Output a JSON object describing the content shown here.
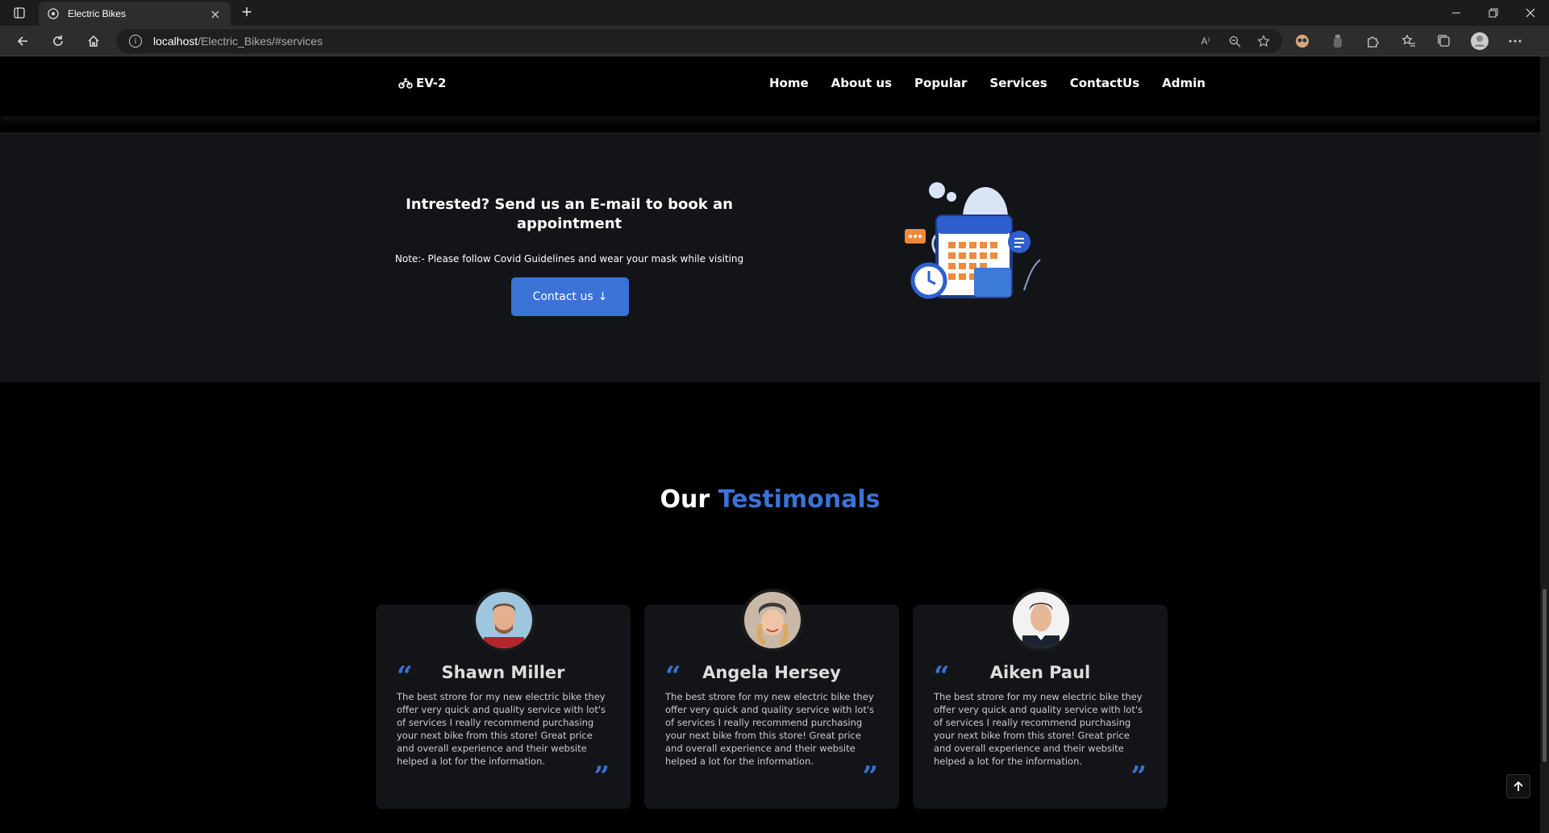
{
  "browser": {
    "tab_title": "Electric Bikes",
    "tab_close": "×",
    "new_tab": "+",
    "url_host": "localhost",
    "url_path": "/Electric_Bikes/#services",
    "read_aloud": "A⁾"
  },
  "site": {
    "brand": "EV-2",
    "nav": [
      "Home",
      "About us",
      "Popular",
      "Services",
      "ContactUs",
      "Admin"
    ]
  },
  "appointment": {
    "title": "Intrested? Send us an E-mail to book an appointment",
    "note": "Note:- Please follow Covid Guidelines and wear your mask while visiting",
    "button_label": "Contact us",
    "button_arrow": "↓"
  },
  "testimonials": {
    "heading_white": "Our",
    "heading_accent": "Testimonals",
    "quote_open": "“",
    "quote_close": "”",
    "cards": [
      {
        "name": "Shawn Miller",
        "text": "The best strore for my new electric bike they offer very quick and quality service with lot's of services I really recommend purchasing your next bike from this store! Great price and overall experience and their website helped a lot for the information."
      },
      {
        "name": "Angela Hersey",
        "text": "The best strore for my new electric bike they offer very quick and quality service with lot's of services I really recommend purchasing your next bike from this store! Great price and overall experience and their website helped a lot for the information."
      },
      {
        "name": "Aiken Paul",
        "text": "The best strore for my new electric bike they offer very quick and quality service with lot's of services I really recommend purchasing your next bike from this store! Great price and overall experience and their website helped a lot for the information."
      }
    ]
  },
  "colors": {
    "accent": "#3a72d6",
    "section_bg": "#121418",
    "page_bg": "#000000"
  }
}
